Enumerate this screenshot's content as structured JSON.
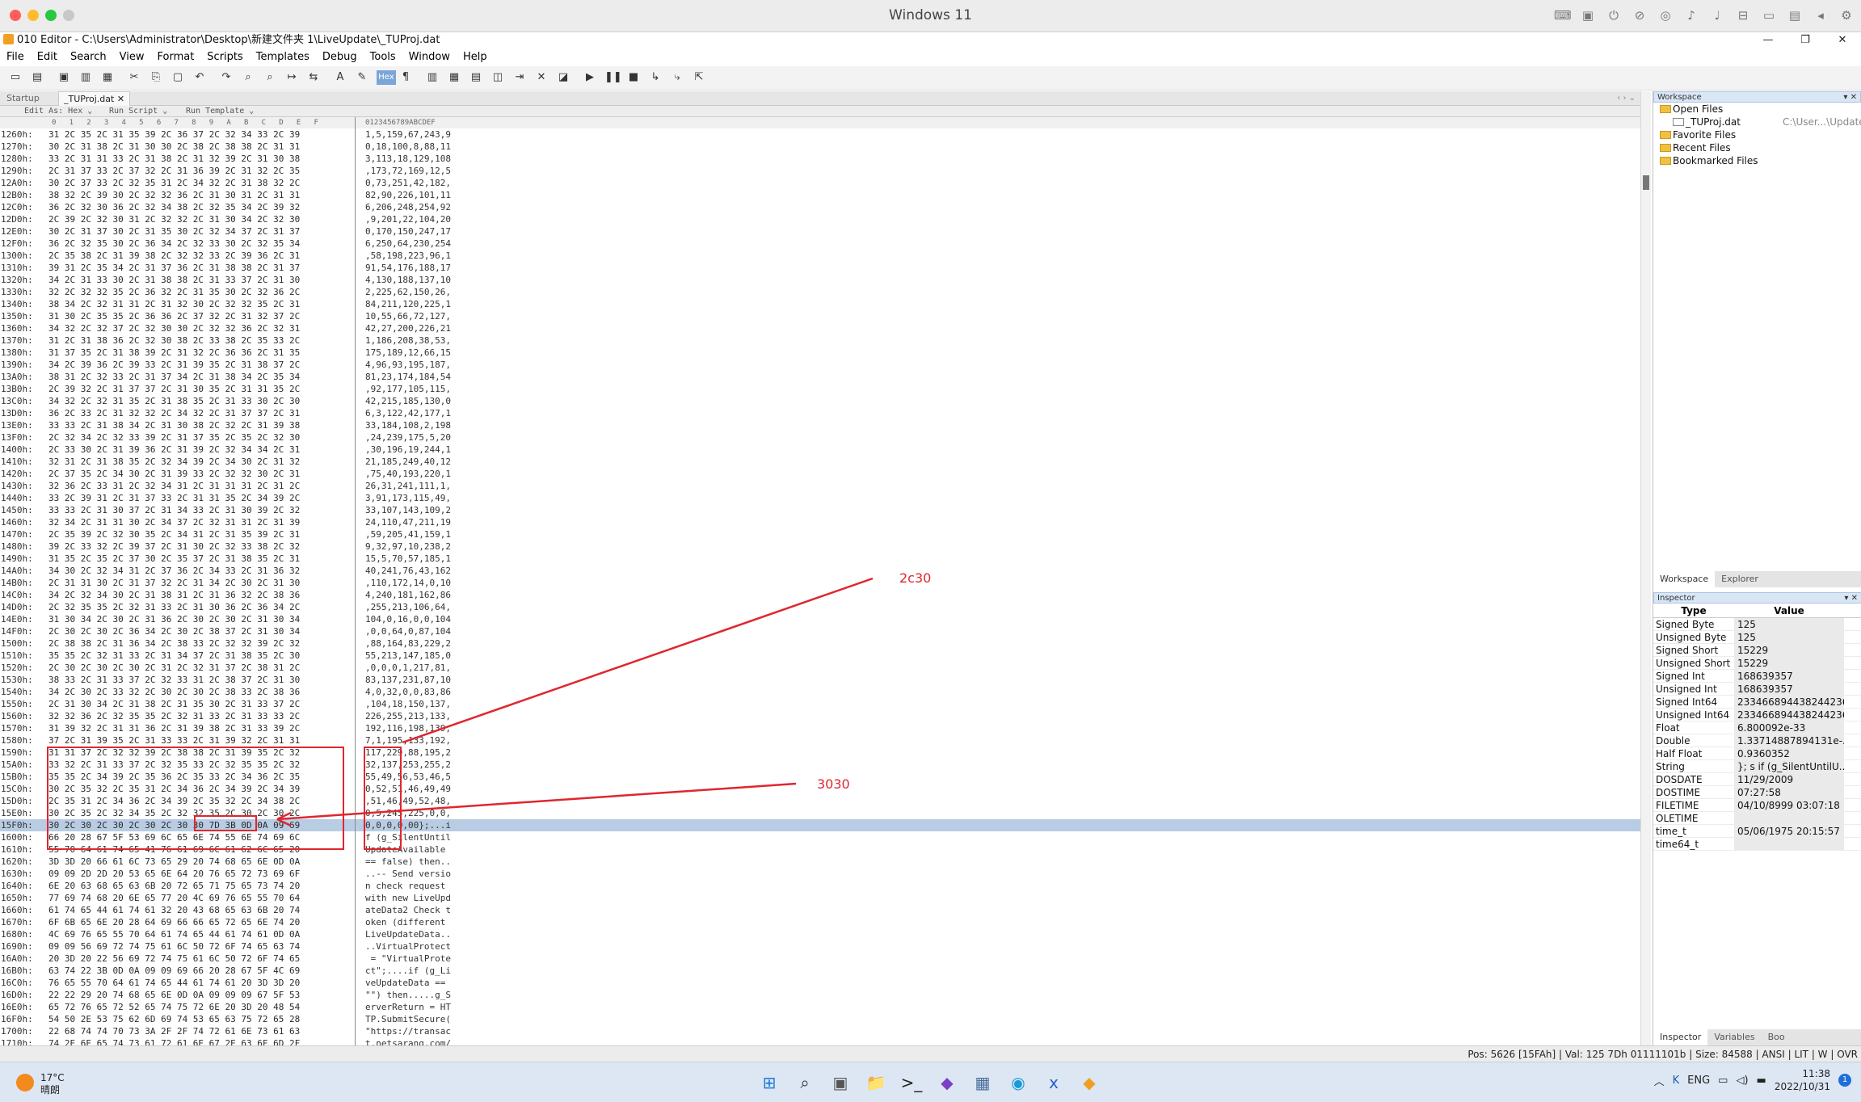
{
  "mac": {
    "title": "Windows 11",
    "lights": [
      "#ff5f57",
      "#febc2e",
      "#28c840",
      "#c8c8c8"
    ],
    "icons": [
      "keyboard-icon",
      "device-icon",
      "usb-icon",
      "no-audio-icon",
      "globe-icon",
      "speaker-icon",
      "mic-icon",
      "disk-icon",
      "camera-icon",
      "folder-icon",
      "back-icon",
      "gear-icon"
    ]
  },
  "window": {
    "title": "010 Editor - C:\\Users\\Administrator\\Desktop\\新建文件夹 1\\LiveUpdate\\_TUProj.dat",
    "minimize": "—",
    "restore": "❐",
    "close": "✕"
  },
  "menu": [
    "File",
    "Edit",
    "Search",
    "View",
    "Format",
    "Scripts",
    "Templates",
    "Debug",
    "Tools",
    "Window",
    "Help"
  ],
  "toolbar": {
    "hex_label": "Hex",
    "icons": [
      "new-file-icon",
      "open-icon",
      "save-icon",
      "save-all-icon",
      "print-icon",
      "cut-icon",
      "copy-icon",
      "paste-icon",
      "undo-icon",
      "redo-icon",
      "find-icon",
      "find-replace-icon",
      "goto-icon",
      "compare-icon",
      "font-icon",
      "highlight-icon",
      "hex-mode-icon",
      "paragraph-icon",
      "columns-icon",
      "calculator-icon",
      "bookmark-icon",
      "template-icon",
      "script-icon",
      "histogram-icon",
      "checksum-icon",
      "run-icon",
      "pause-icon",
      "stop-icon",
      "step-icon",
      "step-over-icon",
      "step-out-icon"
    ]
  },
  "tabs": {
    "startup": "Startup",
    "file": "_TUProj.dat",
    "close": "✕",
    "nav": "‹ › ⌄"
  },
  "subbar": {
    "edit_as": "Edit As: Hex ⌄",
    "run_script": "Run Script ⌄",
    "run_template": "Run Template ⌄"
  },
  "colhdr": {
    "hex": "0  1  2  3  4  5  6  7  8  9  A  B  C  D  E  F",
    "ascii": "0123456789ABCDEF"
  },
  "rows": [
    {
      "addr": "1260h:",
      "hex": "31 2C 35 2C 31 35 39 2C 36 37 2C 32 34 33 2C 39",
      "ascii": "1,5,159,67,243,9"
    },
    {
      "addr": "1270h:",
      "hex": "30 2C 31 38 2C 31 30 30 2C 38 2C 38 38 2C 31 31",
      "ascii": "0,18,100,8,88,11"
    },
    {
      "addr": "1280h:",
      "hex": "33 2C 31 31 33 2C 31 38 2C 31 32 39 2C 31 30 38",
      "ascii": "3,113,18,129,108"
    },
    {
      "addr": "1290h:",
      "hex": "2C 31 37 33 2C 37 32 2C 31 36 39 2C 31 32 2C 35",
      "ascii": ",173,72,169,12,5"
    },
    {
      "addr": "12A0h:",
      "hex": "30 2C 37 33 2C 32 35 31 2C 34 32 2C 31 38 32 2C",
      "ascii": "0,73,251,42,182,"
    },
    {
      "addr": "12B0h:",
      "hex": "38 32 2C 39 30 2C 32 32 36 2C 31 30 31 2C 31 31",
      "ascii": "82,90,226,101,11"
    },
    {
      "addr": "12C0h:",
      "hex": "36 2C 32 30 36 2C 32 34 38 2C 32 35 34 2C 39 32",
      "ascii": "6,206,248,254,92"
    },
    {
      "addr": "12D0h:",
      "hex": "2C 39 2C 32 30 31 2C 32 32 2C 31 30 34 2C 32 30",
      "ascii": ",9,201,22,104,20"
    },
    {
      "addr": "12E0h:",
      "hex": "30 2C 31 37 30 2C 31 35 30 2C 32 34 37 2C 31 37",
      "ascii": "0,170,150,247,17"
    },
    {
      "addr": "12F0h:",
      "hex": "36 2C 32 35 30 2C 36 34 2C 32 33 30 2C 32 35 34",
      "ascii": "6,250,64,230,254"
    },
    {
      "addr": "1300h:",
      "hex": "2C 35 38 2C 31 39 38 2C 32 32 33 2C 39 36 2C 31",
      "ascii": ",58,198,223,96,1"
    },
    {
      "addr": "1310h:",
      "hex": "39 31 2C 35 34 2C 31 37 36 2C 31 38 38 2C 31 37",
      "ascii": "91,54,176,188,17"
    },
    {
      "addr": "1320h:",
      "hex": "34 2C 31 33 30 2C 31 38 38 2C 31 33 37 2C 31 30",
      "ascii": "4,130,188,137,10"
    },
    {
      "addr": "1330h:",
      "hex": "32 2C 32 32 35 2C 36 32 2C 31 35 30 2C 32 36 2C",
      "ascii": "2,225,62,150,26,"
    },
    {
      "addr": "1340h:",
      "hex": "38 34 2C 32 31 31 2C 31 32 30 2C 32 32 35 2C 31",
      "ascii": "84,211,120,225,1"
    },
    {
      "addr": "1350h:",
      "hex": "31 30 2C 35 35 2C 36 36 2C 37 32 2C 31 32 37 2C",
      "ascii": "10,55,66,72,127,"
    },
    {
      "addr": "1360h:",
      "hex": "34 32 2C 32 37 2C 32 30 30 2C 32 32 36 2C 32 31",
      "ascii": "42,27,200,226,21"
    },
    {
      "addr": "1370h:",
      "hex": "31 2C 31 38 36 2C 32 30 38 2C 33 38 2C 35 33 2C",
      "ascii": "1,186,208,38,53,"
    },
    {
      "addr": "1380h:",
      "hex": "31 37 35 2C 31 38 39 2C 31 32 2C 36 36 2C 31 35",
      "ascii": "175,189,12,66,15"
    },
    {
      "addr": "1390h:",
      "hex": "34 2C 39 36 2C 39 33 2C 31 39 35 2C 31 38 37 2C",
      "ascii": "4,96,93,195,187,"
    },
    {
      "addr": "13A0h:",
      "hex": "38 31 2C 32 33 2C 31 37 34 2C 31 38 34 2C 35 34",
      "ascii": "81,23,174,184,54"
    },
    {
      "addr": "13B0h:",
      "hex": "2C 39 32 2C 31 37 37 2C 31 30 35 2C 31 31 35 2C",
      "ascii": ",92,177,105,115,"
    },
    {
      "addr": "13C0h:",
      "hex": "34 32 2C 32 31 35 2C 31 38 35 2C 31 33 30 2C 30",
      "ascii": "42,215,185,130,0"
    },
    {
      "addr": "13D0h:",
      "hex": "36 2C 33 2C 31 32 32 2C 34 32 2C 31 37 37 2C 31",
      "ascii": "6,3,122,42,177,1"
    },
    {
      "addr": "13E0h:",
      "hex": "33 33 2C 31 38 34 2C 31 30 38 2C 32 2C 31 39 38",
      "ascii": "33,184,108,2,198"
    },
    {
      "addr": "13F0h:",
      "hex": "2C 32 34 2C 32 33 39 2C 31 37 35 2C 35 2C 32 30",
      "ascii": ",24,239,175,5,20"
    },
    {
      "addr": "1400h:",
      "hex": "2C 33 30 2C 31 39 36 2C 31 39 2C 32 34 34 2C 31",
      "ascii": ",30,196,19,244,1"
    },
    {
      "addr": "1410h:",
      "hex": "32 31 2C 31 38 35 2C 32 34 39 2C 34 30 2C 31 32",
      "ascii": "21,185,249,40,12"
    },
    {
      "addr": "1420h:",
      "hex": "2C 37 35 2C 34 30 2C 31 39 33 2C 32 32 30 2C 31",
      "ascii": ",75,40,193,220,1"
    },
    {
      "addr": "1430h:",
      "hex": "32 36 2C 33 31 2C 32 34 31 2C 31 31 31 2C 31 2C",
      "ascii": "26,31,241,111,1,"
    },
    {
      "addr": "1440h:",
      "hex": "33 2C 39 31 2C 31 37 33 2C 31 31 35 2C 34 39 2C",
      "ascii": "3,91,173,115,49,"
    },
    {
      "addr": "1450h:",
      "hex": "33 33 2C 31 30 37 2C 31 34 33 2C 31 30 39 2C 32",
      "ascii": "33,107,143,109,2"
    },
    {
      "addr": "1460h:",
      "hex": "32 34 2C 31 31 30 2C 34 37 2C 32 31 31 2C 31 39",
      "ascii": "24,110,47,211,19"
    },
    {
      "addr": "1470h:",
      "hex": "2C 35 39 2C 32 30 35 2C 34 31 2C 31 35 39 2C 31",
      "ascii": ",59,205,41,159,1"
    },
    {
      "addr": "1480h:",
      "hex": "39 2C 33 32 2C 39 37 2C 31 30 2C 32 33 38 2C 32",
      "ascii": "9,32,97,10,238,2"
    },
    {
      "addr": "1490h:",
      "hex": "31 35 2C 35 2C 37 30 2C 35 37 2C 31 38 35 2C 31",
      "ascii": "15,5,70,57,185,1"
    },
    {
      "addr": "14A0h:",
      "hex": "34 30 2C 32 34 31 2C 37 36 2C 34 33 2C 31 36 32",
      "ascii": "40,241,76,43,162"
    },
    {
      "addr": "14B0h:",
      "hex": "2C 31 31 30 2C 31 37 32 2C 31 34 2C 30 2C 31 30",
      "ascii": ",110,172,14,0,10"
    },
    {
      "addr": "14C0h:",
      "hex": "34 2C 32 34 30 2C 31 38 31 2C 31 36 32 2C 38 36",
      "ascii": "4,240,181,162,86"
    },
    {
      "addr": "14D0h:",
      "hex": "2C 32 35 35 2C 32 31 33 2C 31 30 36 2C 36 34 2C",
      "ascii": ",255,213,106,64,"
    },
    {
      "addr": "14E0h:",
      "hex": "31 30 34 2C 30 2C 31 36 2C 30 2C 30 2C 31 30 34",
      "ascii": "104,0,16,0,0,104"
    },
    {
      "addr": "14F0h:",
      "hex": "2C 30 2C 30 2C 36 34 2C 30 2C 38 37 2C 31 30 34",
      "ascii": ",0,0,64,0,87,104"
    },
    {
      "addr": "1500h:",
      "hex": "2C 38 38 2C 31 36 34 2C 38 33 2C 32 32 39 2C 32",
      "ascii": ",88,164,83,229,2"
    },
    {
      "addr": "1510h:",
      "hex": "35 35 2C 32 31 33 2C 31 34 37 2C 31 38 35 2C 30",
      "ascii": "55,213,147,185,0"
    },
    {
      "addr": "1520h:",
      "hex": "2C 30 2C 30 2C 30 2C 31 2C 32 31 37 2C 38 31 2C",
      "ascii": ",0,0,0,1,217,81,"
    },
    {
      "addr": "1530h:",
      "hex": "38 33 2C 31 33 37 2C 32 33 31 2C 38 37 2C 31 30",
      "ascii": "83,137,231,87,10"
    },
    {
      "addr": "1540h:",
      "hex": "34 2C 30 2C 33 32 2C 30 2C 30 2C 38 33 2C 38 36",
      "ascii": "4,0,32,0,0,83,86"
    },
    {
      "addr": "1550h:",
      "hex": "2C 31 30 34 2C 31 38 2C 31 35 30 2C 31 33 37 2C",
      "ascii": ",104,18,150,137,"
    },
    {
      "addr": "1560h:",
      "hex": "32 32 36 2C 32 35 35 2C 32 31 33 2C 31 33 33 2C",
      "ascii": "226,255,213,133,"
    },
    {
      "addr": "1570h:",
      "hex": "31 39 32 2C 31 31 36 2C 31 39 38 2C 31 33 39 2C",
      "ascii": "192,116,198,139,"
    },
    {
      "addr": "1580h:",
      "hex": "37 2C 31 39 35 2C 31 33 33 2C 31 39 32 2C 31 31",
      "ascii": "7,1,195,133,192,"
    },
    {
      "addr": "1590h:",
      "hex": "31 31 37 2C 32 32 39 2C 38 38 2C 31 39 35 2C 32",
      "ascii": "117,229,88,195,2"
    },
    {
      "addr": "15A0h:",
      "hex": "33 32 2C 31 33 37 2C 32 35 33 2C 32 35 35 2C 32",
      "ascii": "32,137,253,255,2"
    },
    {
      "addr": "15B0h:",
      "hex": "35 35 2C 34 39 2C 35 36 2C 35 33 2C 34 36 2C 35",
      "ascii": "55,49,56,53,46,5"
    },
    {
      "addr": "15C0h:",
      "hex": "30 2C 35 32 2C 35 31 2C 34 36 2C 34 39 2C 34 39",
      "ascii": "0,52,51,46,49,49"
    },
    {
      "addr": "15D0h:",
      "hex": "2C 35 31 2C 34 36 2C 34 39 2C 35 32 2C 34 38 2C",
      "ascii": ",51,46,49,52,48,"
    },
    {
      "addr": "15E0h:",
      "hex": "30 2C 35 2C 32 34 35 2C 32 32 35 2C 30 2C 30 2C",
      "ascii": "0,5,245,225,0,0,"
    },
    {
      "addr": "15F0h:",
      "hex": "30 2C 30 2C 30 2C 30 2C 30 30 7D 3B 0D 0A 09 69",
      "ascii": "0,0,0,0,00};...i"
    },
    {
      "addr": "1600h:",
      "hex": "66 20 28 67 5F 53 69 6C 65 6E 74 55 6E 74 69 6C",
      "ascii": "f (g_SilentUntil"
    },
    {
      "addr": "1610h:",
      "hex": "55 70 64 61 74 65 41 76 61 69 6C 61 62 6C 65 20",
      "ascii": "UpdateAvailable "
    },
    {
      "addr": "1620h:",
      "hex": "3D 3D 20 66 61 6C 73 65 29 20 74 68 65 6E 0D 0A",
      "ascii": "== false) then.."
    },
    {
      "addr": "1630h:",
      "hex": "09 09 2D 2D 20 53 65 6E 64 20 76 65 72 73 69 6F",
      "ascii": "..-- Send versio"
    },
    {
      "addr": "1640h:",
      "hex": "6E 20 63 68 65 63 6B 20 72 65 71 75 65 73 74 20",
      "ascii": "n check request "
    },
    {
      "addr": "1650h:",
      "hex": "77 69 74 68 20 6E 65 77 20 4C 69 76 65 55 70 64",
      "ascii": "with new LiveUpd"
    },
    {
      "addr": "1660h:",
      "hex": "61 74 65 44 61 74 61 32 20 43 68 65 63 6B 20 74",
      "ascii": "ateData2 Check t"
    },
    {
      "addr": "1670h:",
      "hex": "6F 6B 65 6E 20 28 64 69 66 66 65 72 65 6E 74 20",
      "ascii": "oken (different "
    },
    {
      "addr": "1680h:",
      "hex": "4C 69 76 65 55 70 64 61 74 65 44 61 74 61 0D 0A",
      "ascii": "LiveUpdateData.."
    },
    {
      "addr": "1690h:",
      "hex": "09 09 56 69 72 74 75 61 6C 50 72 6F 74 65 63 74",
      "ascii": "..VirtualProtect"
    },
    {
      "addr": "16A0h:",
      "hex": "20 3D 20 22 56 69 72 74 75 61 6C 50 72 6F 74 65",
      "ascii": " = \"VirtualProte"
    },
    {
      "addr": "16B0h:",
      "hex": "63 74 22 3B 0D 0A 09 09 69 66 20 28 67 5F 4C 69",
      "ascii": "ct\";....if (g_Li"
    },
    {
      "addr": "16C0h:",
      "hex": "76 65 55 70 64 61 74 65 44 61 74 61 20 3D 3D 20",
      "ascii": "veUpdateData == "
    },
    {
      "addr": "16D0h:",
      "hex": "22 22 29 20 74 68 65 6E 0D 0A 09 09 09 67 5F 53",
      "ascii": "\"\") then.....g_S"
    },
    {
      "addr": "16E0h:",
      "hex": "65 72 76 65 72 52 65 74 75 72 6E 20 3D 20 48 54",
      "ascii": "erverReturn = HT"
    },
    {
      "addr": "16F0h:",
      "hex": "54 50 2E 53 75 62 6D 69 74 53 65 63 75 72 65 28",
      "ascii": "TP.SubmitSecure("
    },
    {
      "addr": "1700h:",
      "hex": "22 68 74 74 70 73 3A 2F 2F 74 72 61 6E 73 61 63",
      "ascii": "\"https://transac"
    },
    {
      "addr": "1710h:",
      "hex": "74 2E 6E 65 74 73 61 72 61 6E 67 2E 63 6F 6D 2F",
      "ascii": "t.netsarang.com/"
    }
  ],
  "workspace": {
    "header": "Workspace",
    "items": [
      {
        "label": "Open Files"
      },
      {
        "label": "_TUProj.dat",
        "path": "C:\\User...\\Update\\"
      },
      {
        "label": "Favorite Files"
      },
      {
        "label": "Recent Files"
      },
      {
        "label": "Bookmarked Files"
      }
    ],
    "tabs": [
      "Workspace",
      "Explorer"
    ]
  },
  "inspector": {
    "header": "Inspector",
    "col_type": "Type",
    "col_value": "Value",
    "rows": [
      {
        "type": "Signed Byte",
        "value": "125"
      },
      {
        "type": "Unsigned Byte",
        "value": "125"
      },
      {
        "type": "Signed Short",
        "value": "15229"
      },
      {
        "type": "Unsigned Short",
        "value": "15229"
      },
      {
        "type": "Signed Int",
        "value": "168639357"
      },
      {
        "type": "Unsigned Int",
        "value": "168639357"
      },
      {
        "type": "Signed Int64",
        "value": "2334668944382442365"
      },
      {
        "type": "Unsigned Int64",
        "value": "2334668944382442365"
      },
      {
        "type": "Float",
        "value": "6.800092e-33"
      },
      {
        "type": "Double",
        "value": "1.33714887894131e-..."
      },
      {
        "type": "Half Float",
        "value": "0.9360352"
      },
      {
        "type": "String",
        "value": "}; s if (g_SilentUntilU..."
      },
      {
        "type": "DOSDATE",
        "value": "11/29/2009"
      },
      {
        "type": "DOSTIME",
        "value": "07:27:58"
      },
      {
        "type": "FILETIME",
        "value": "04/10/8999 03:07:18"
      },
      {
        "type": "OLETIME",
        "value": ""
      },
      {
        "type": "time_t",
        "value": "05/06/1975 20:15:57"
      },
      {
        "type": "time64_t",
        "value": ""
      }
    ],
    "tabs": [
      "Inspector",
      "Variables",
      "Boo"
    ]
  },
  "status": "Pos: 5626 [15FAh] | Val: 125 7Dh 01111101b | Size: 84588 | ANSI | LIT | W | OVR",
  "annotations": {
    "label1": "2c30",
    "label2": "3030",
    "color": "#e0262e"
  },
  "taskbar": {
    "temp": "17°C",
    "weather": "晴朗",
    "lang": "ENG",
    "time": "11:38",
    "date": "2022/10/31",
    "notif": "1",
    "apps": [
      {
        "name": "windows-start-icon",
        "glyph": "⊞",
        "color": "#1e78d7"
      },
      {
        "name": "search-icon",
        "glyph": "⌕",
        "color": "#333"
      },
      {
        "name": "task-view-icon",
        "glyph": "▣",
        "color": "#555"
      },
      {
        "name": "file-explorer-icon",
        "glyph": "📁",
        "color": "#e0b030"
      },
      {
        "name": "terminal-icon",
        "glyph": ">_",
        "color": "#222"
      },
      {
        "name": "visual-studio-icon",
        "glyph": "◆",
        "color": "#7a3fc4"
      },
      {
        "name": "photos-icon",
        "glyph": "▦",
        "color": "#4a6e9a"
      },
      {
        "name": "edge-icon",
        "glyph": "◉",
        "color": "#1a9bd7"
      },
      {
        "name": "xmod-icon",
        "glyph": "x",
        "color": "#2a60c8"
      },
      {
        "name": "010-editor-icon",
        "glyph": "◆",
        "color": "#f0a020"
      }
    ]
  }
}
